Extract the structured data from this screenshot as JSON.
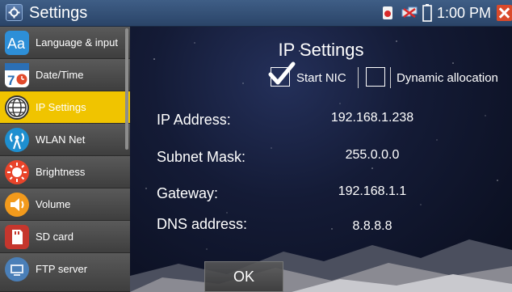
{
  "window": {
    "title": "Settings",
    "time": "1:00 PM"
  },
  "status_icons": [
    "record-icon",
    "network-icon",
    "battery-icon",
    "close-icon"
  ],
  "sidebar": {
    "items": [
      {
        "label": "Language & input",
        "icon": "language-icon",
        "color": "#2d8fd8"
      },
      {
        "label": "Date/Time",
        "icon": "calendar-icon",
        "color": "#ffffff"
      },
      {
        "label": "IP Settings",
        "icon": "globe-icon",
        "color": "#ffffff",
        "active": true
      },
      {
        "label": "WLAN Net",
        "icon": "wifi-antenna-icon",
        "color": "#1e8fd0"
      },
      {
        "label": "Brightness",
        "icon": "brightness-icon",
        "color": "#e9442a"
      },
      {
        "label": "Volume",
        "icon": "volume-icon",
        "color": "#f29a1c"
      },
      {
        "label": "SD card",
        "icon": "sd-card-icon",
        "color": "#c5362d"
      },
      {
        "label": "FTP server",
        "icon": "ftp-server-icon",
        "color": "#4a7fb8"
      }
    ]
  },
  "main": {
    "title": "IP Settings",
    "start_nic": {
      "label": "Start NIC",
      "checked": true
    },
    "dynamic_allocation": {
      "label": "Dynamic allocation",
      "checked": false
    },
    "fields": [
      {
        "label": "IP Address:",
        "value": "192.168.1.238"
      },
      {
        "label": "Subnet Mask:",
        "value": "255.0.0.0"
      },
      {
        "label": "Gateway:",
        "value": "192.168.1.1"
      },
      {
        "label": "DNS address:",
        "value": "8.8.8.8"
      }
    ],
    "ok_label": "OK"
  },
  "colors": {
    "active_item": "#f0c400",
    "titlebar": "#34507a",
    "close": "#d94a2b"
  }
}
